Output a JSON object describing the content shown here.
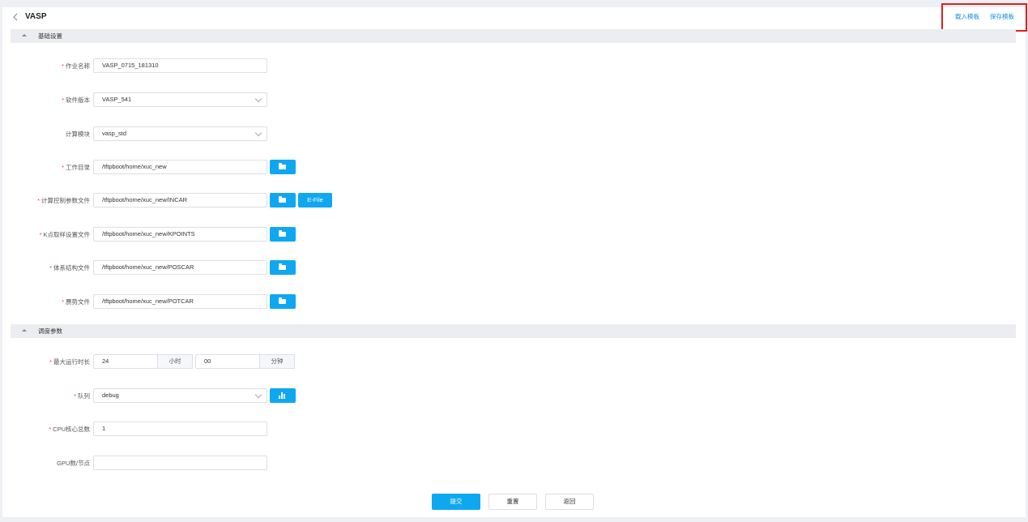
{
  "header": {
    "title": "VASP",
    "load_template": "载入模板",
    "save_template": "保存模板"
  },
  "sections": {
    "basic": "基础设置",
    "schedule": "调度参数"
  },
  "form": {
    "job_name": {
      "label": "作业名称",
      "value": "VASP_0715_181310"
    },
    "software_version": {
      "label": "软件版本",
      "value": "VASP_541"
    },
    "compute_module": {
      "label": "计算模块",
      "value": "vasp_std"
    },
    "work_dir": {
      "label": "工作目录",
      "value": "/tftpboot/home/xuc_new"
    },
    "incar": {
      "label": "计算控制参数文件",
      "value": "/tftpboot/home/xuc_new/INCAR",
      "efile_label": "E-File"
    },
    "kpoints": {
      "label": "K点取样设置文件",
      "value": "/tftpboot/home/xuc_new/KPOINTS"
    },
    "poscar": {
      "label": "体系结构文件",
      "value": "/tftpboot/home/xuc_new/POSCAR"
    },
    "potcar": {
      "label": "赝势文件",
      "value": "/tftpboot/home/xuc_new/POTCAR"
    },
    "max_runtime": {
      "label": "最大运行时长",
      "hours": "24",
      "hours_unit": "小时",
      "minutes": "00",
      "minutes_unit": "分钟"
    },
    "queue": {
      "label": "队列",
      "value": "debug"
    },
    "cpu_cores": {
      "label": "CPU核心总数",
      "value": "1"
    },
    "gpu_per_node": {
      "label": "GPU数/节点",
      "value": ""
    }
  },
  "actions": {
    "submit": "提交",
    "reset": "重置",
    "back": "返回"
  },
  "colors": {
    "primary": "#0fa8f0",
    "required": "#e5474b",
    "link": "#1a8fe3",
    "highlight_border": "#e02020"
  }
}
